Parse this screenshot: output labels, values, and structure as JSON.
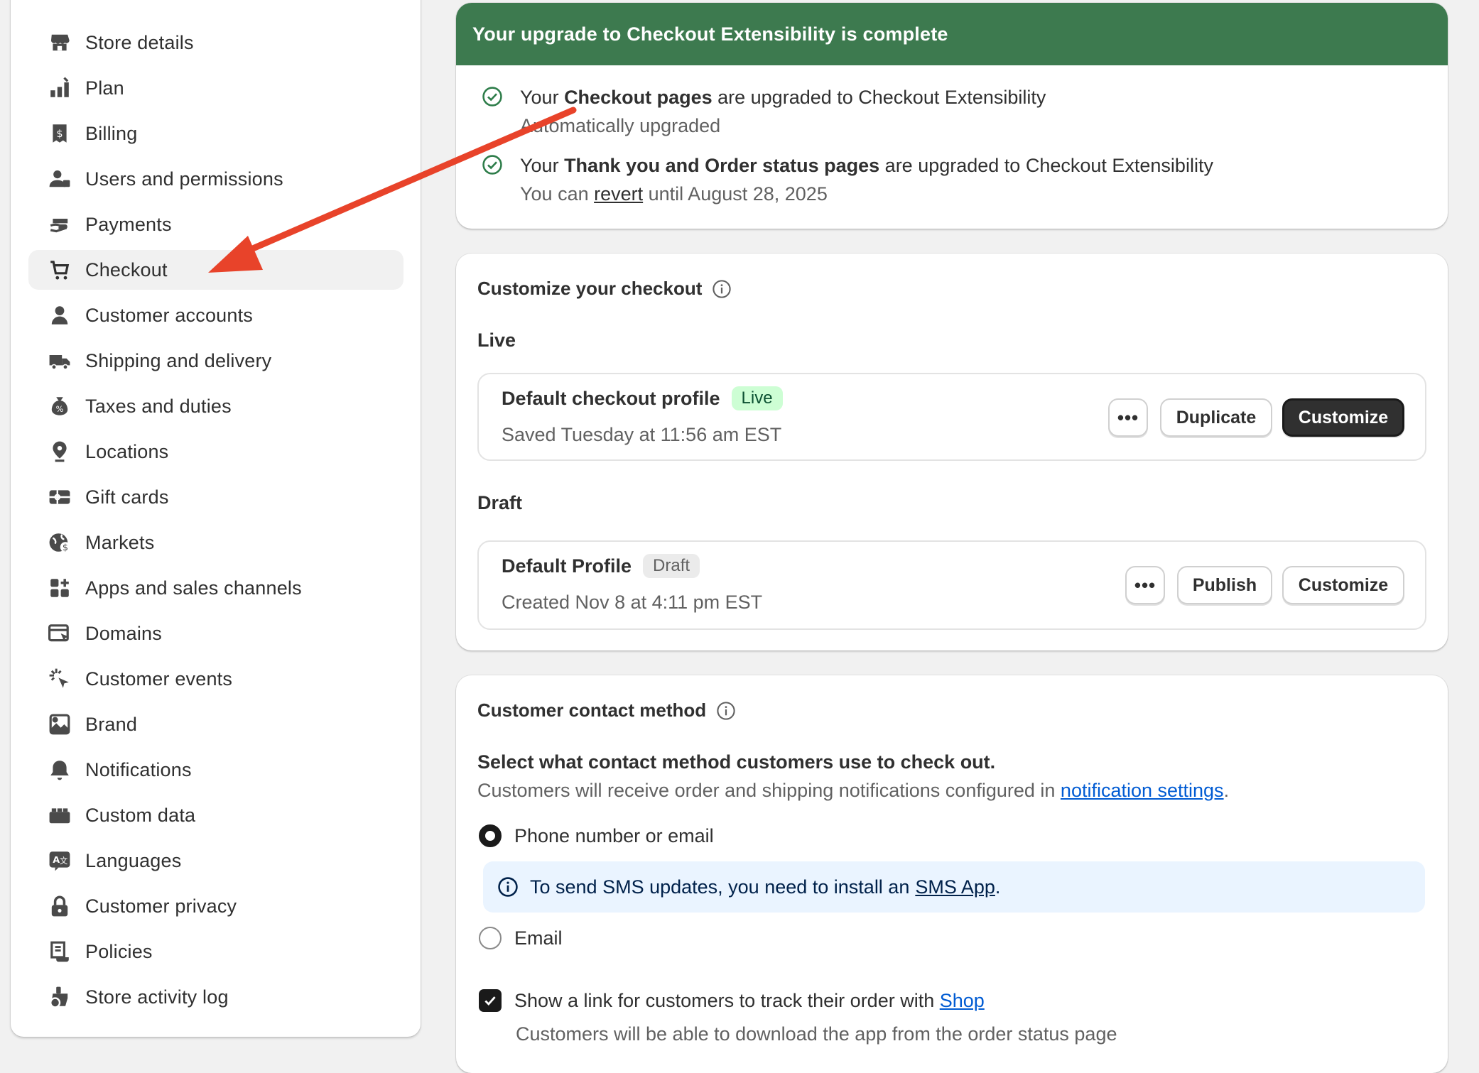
{
  "sidebar": {
    "items": [
      {
        "label": "Store details",
        "icon": "store-icon"
      },
      {
        "label": "Plan",
        "icon": "plan-icon"
      },
      {
        "label": "Billing",
        "icon": "billing-icon"
      },
      {
        "label": "Users and permissions",
        "icon": "users-icon"
      },
      {
        "label": "Payments",
        "icon": "payments-icon"
      },
      {
        "label": "Checkout",
        "icon": "cart-icon",
        "active": true
      },
      {
        "label": "Customer accounts",
        "icon": "person-icon"
      },
      {
        "label": "Shipping and delivery",
        "icon": "truck-icon"
      },
      {
        "label": "Taxes and duties",
        "icon": "tax-icon"
      },
      {
        "label": "Locations",
        "icon": "location-icon"
      },
      {
        "label": "Gift cards",
        "icon": "gift-card-icon"
      },
      {
        "label": "Markets",
        "icon": "globe-icon"
      },
      {
        "label": "Apps and sales channels",
        "icon": "apps-icon"
      },
      {
        "label": "Domains",
        "icon": "domains-icon"
      },
      {
        "label": "Customer events",
        "icon": "cursor-click-icon"
      },
      {
        "label": "Brand",
        "icon": "brand-icon"
      },
      {
        "label": "Notifications",
        "icon": "bell-icon"
      },
      {
        "label": "Custom data",
        "icon": "custom-data-icon"
      },
      {
        "label": "Languages",
        "icon": "language-icon"
      },
      {
        "label": "Customer privacy",
        "icon": "lock-icon"
      },
      {
        "label": "Policies",
        "icon": "policies-icon"
      },
      {
        "label": "Store activity log",
        "icon": "activity-icon"
      }
    ]
  },
  "upgrade_banner": {
    "title": "Your upgrade to Checkout Extensibility is complete",
    "item1_pre": "Your ",
    "item1_bold": "Checkout pages",
    "item1_post": " are upgraded to Checkout Extensibility",
    "item1_sub": "Automatically upgraded",
    "item2_pre": "Your ",
    "item2_bold": "Thank you and Order status pages",
    "item2_post": " are upgraded to Checkout Extensibility",
    "item2_sub_pre": "You can ",
    "item2_sub_link": "revert",
    "item2_sub_post": " until August 28, 2025"
  },
  "customize": {
    "title": "Customize your checkout",
    "live_label": "Live",
    "live_profile": {
      "name": "Default checkout profile",
      "badge": "Live",
      "meta": "Saved Tuesday at 11:56 am EST",
      "more": "•••",
      "duplicate": "Duplicate",
      "customize": "Customize"
    },
    "draft_label": "Draft",
    "draft_profile": {
      "name": "Default Profile",
      "badge": "Draft",
      "meta": "Created Nov 8 at 4:11 pm EST",
      "more": "•••",
      "publish": "Publish",
      "customize": "Customize"
    }
  },
  "contact": {
    "title": "Customer contact method",
    "desc_bold": "Select what contact method customers use to check out.",
    "desc_pre": "Customers will receive order and shipping notifications configured in ",
    "desc_link": "notification settings",
    "desc_post": ".",
    "option1": "Phone number or email",
    "option1_selected": true,
    "callout_pre": "To send SMS updates, you need to install an ",
    "callout_link": "SMS App",
    "callout_post": ".",
    "option2": "Email",
    "option2_selected": false,
    "shop_pre": "Show a link for customers to track their order with ",
    "shop_link": "Shop",
    "shop_checked": true,
    "shop_note": "Customers will be able to download the app from the order status page"
  },
  "colors": {
    "banner_green": "#3d7a4f",
    "annotation_arrow": "#e8432a",
    "link_blue": "#005bd3",
    "live_badge_bg": "#cdfed4"
  }
}
